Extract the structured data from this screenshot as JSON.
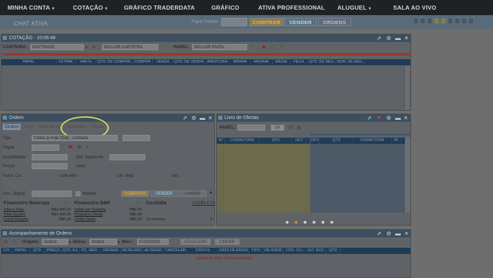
{
  "nav": {
    "items": [
      {
        "label": "MINHA CONTA",
        "caret": "▾"
      },
      {
        "label": "COTAÇÃO",
        "caret": "▾"
      },
      {
        "label": "GRÁFICO TRADERDATA",
        "caret": ""
      },
      {
        "label": "GRÁFICO",
        "caret": ""
      },
      {
        "label": "ATIVA PROFESSIONAL",
        "caret": ""
      },
      {
        "label": "ALUGUEL",
        "caret": "▾"
      },
      {
        "label": "SALA AO VIVO",
        "caret": ""
      }
    ]
  },
  "subbar": {
    "chat_tab": "CHAT ATIVA",
    "paper_label": "Papel Padrão",
    "buy": "COMPRAR",
    "sell": "VENDER",
    "orders": "ORDENS"
  },
  "quote": {
    "title": "COTAÇÃO - 10:06:48",
    "portfolio_label": "CARTEIRA:",
    "portfolio_value": "DAYTRADE",
    "include_portfolio": "INCLUIR CARTEIRA",
    "paper_label": "PAPEL:",
    "include_paper": "INCLUIR PAPEL",
    "columns": [
      "PAPEL",
      "ÚLTIMA",
      "VAR.%",
      "QTD. DE COMPRA",
      "COMPRA",
      "VENDA",
      "QTD. DE VENDA",
      "ABERTURA",
      "MÍNIMA",
      "MÁXIMA",
      "MÉDIA",
      "FECH.",
      "QTD. DE NEG.",
      "NUM. DE NEG."
    ]
  },
  "order": {
    "title": "Ordem",
    "tabs": [
      "Ordem",
      "Stop",
      "Stop Móvel",
      "Aparente",
      "Títulos"
    ],
    "type_label": "Tipo",
    "type_value": "Válida p/ hoje (Dia) - Limitada",
    "paper_label": "Papel",
    "qty_label": "Quantidade",
    "apparent_qty_label": "Qtd. Aparente",
    "price_label": "Preço",
    "value_label": "Valor",
    "factor_label": "Fator Cot.",
    "min_lot_label": "Lote Mín.",
    "last_neg_label": "Últ. Neg.",
    "var_label": "Var.",
    "signature_label": "Ass. Digital",
    "keep_label": "Manter",
    "buy": "COMPRAR",
    "sell": "VENDER",
    "clear": "LIMPAR",
    "fin_bovespa": "Financeiro Bovespa",
    "fin_bmf": "Financeiro BMF",
    "custody": "Custódia",
    "complete": "COMPLETO",
    "bovespa_rows": [
      {
        "label": "Total à Vista",
        "value": "R$2.400,00"
      },
      {
        "label": "Total Opções",
        "value": "R$2.400,00"
      },
      {
        "label": "Conta Margem",
        "value": "R$0,00"
      }
    ],
    "bmf_rows": [
      {
        "label": "Saldo em Garantia",
        "value": "R$0,00"
      },
      {
        "label": "Bloqueios (Total)",
        "value": "R$0,00"
      },
      {
        "label": "Limite Diário",
        "value": "R$0,00"
      }
    ],
    "custody_qty_label": "Quantidade",
    "custody_qty_value": "0"
  },
  "book": {
    "title": "Livro de Ofertas",
    "paper_label": "PAPEL:",
    "ok": "OK",
    "columns_left": [
      "Nº",
      "CORRETORA",
      "QTD",
      "OFC"
    ],
    "columns_right": [
      "OFV",
      "QTD",
      "CORRETORA",
      "Nº"
    ]
  },
  "tracking": {
    "title": "Acompanhamento de Ordens",
    "origin_label": "Origem:",
    "origin_value": "Ambos",
    "exchange_label": "Bolsa:",
    "exchange_value": "Ambos",
    "mov_label": "Mov.:",
    "mov_value": "07/02/2020",
    "update": "ATUALIZAR",
    "clear": "LIMPAR",
    "columns": [
      "C/V",
      "PAPEL",
      "QTD.",
      "PREÇO",
      "QTD. EX.",
      "PÇ. MED.",
      "ORIGEM",
      "DETALHES",
      "ALTERAR",
      "CANCELAR",
      "STATUS",
      "DATA DE ENVIO",
      "TIPO",
      "VALIDADE",
      "CÓD. CLI.",
      "ÚLT. ACC",
      "QTD"
    ],
    "empty": "Nenhum item foi encontrado."
  },
  "colors": {
    "highlight": "#d5d85a",
    "error_text": "#8b2020"
  }
}
